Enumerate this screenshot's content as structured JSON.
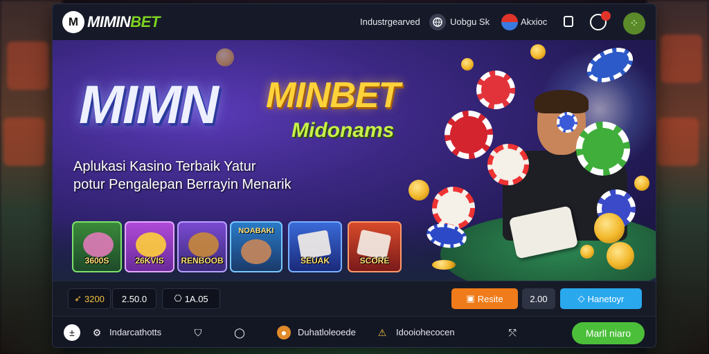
{
  "header": {
    "brand_mark": "M",
    "brand_white": "MIMIN",
    "brand_green": "BET",
    "link_1": "Industrgearved",
    "link_2_icon": "globe-icon",
    "link_2": "Uobgu Sk",
    "link_3_icon": "flag-icon",
    "link_3": "Akxioc"
  },
  "hero": {
    "title_main": "MIMN",
    "title_brand": "MINBET",
    "title_sub": "Midonams",
    "tagline_1": "Aplukasi Kasino Terbaik Yatur",
    "tagline_2": "potur Pengalepan Berrayin Menarik"
  },
  "games": [
    {
      "label": "3600S",
      "top": ""
    },
    {
      "label": "26KVIS",
      "top": ""
    },
    {
      "label": "RENBOOB",
      "top": ""
    },
    {
      "label": "",
      "top": "NOABAKI"
    },
    {
      "label": "SEUAK",
      "top": ""
    },
    {
      "label": "SCORE",
      "top": ""
    }
  ],
  "controls": {
    "balance_1": "3200",
    "balance_2": "2.50.0",
    "balance_3": "1A.05",
    "reset_label": "Resite",
    "bet_value": "2.00",
    "auto_label": "Hanetoyr"
  },
  "bottom_nav": {
    "item_1": "Indarcathotts",
    "item_2": "Duhatloleoede",
    "item_3": "Idooiohecocen",
    "cta_label": "Marll niaro"
  },
  "colors": {
    "accent_green": "#7ed321",
    "button_orange": "#f07b1a",
    "button_blue": "#2aa8ee",
    "cta_green": "#4cbf3a"
  }
}
